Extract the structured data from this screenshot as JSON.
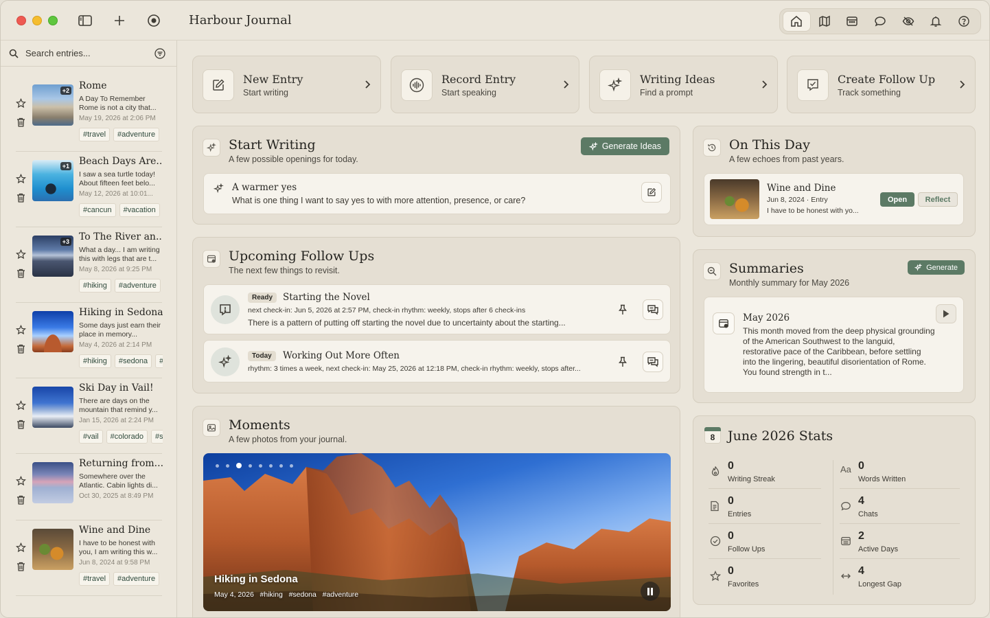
{
  "app": {
    "title": "Harbour Journal"
  },
  "search": {
    "placeholder": "Search entries..."
  },
  "entries": [
    {
      "title": "Rome",
      "snippet": "A Day To Remember Rome is not a city that...",
      "date": "May 19, 2026 at 2:06 PM",
      "badge": "+2",
      "tags": [
        "#travel",
        "#adventure"
      ]
    },
    {
      "title": "Beach Days Are...",
      "snippet": "I saw a sea turtle today! About fifteen feet belo...",
      "date": "May 12, 2026 at 10:01...",
      "badge": "+1",
      "tags": [
        "#cancun",
        "#vacation"
      ]
    },
    {
      "title": "To The River an...",
      "snippet": "What a day... I am writing this with legs that are t...",
      "date": "May 8, 2026 at 9:25 PM",
      "badge": "+3",
      "tags": [
        "#hiking",
        "#adventure"
      ]
    },
    {
      "title": "Hiking in Sedona",
      "snippet": "Some days just earn their place in memory...",
      "date": "May 4, 2026 at 2:14 PM",
      "badge": "",
      "tags": [
        "#hiking",
        "#sedona",
        "#adventure"
      ]
    },
    {
      "title": "Ski Day in Vail!",
      "snippet": "There are days on the mountain that remind y...",
      "date": "Jan 15, 2026 at 2:24 PM",
      "badge": "",
      "tags": [
        "#vail",
        "#colorado",
        "#ski"
      ]
    },
    {
      "title": "Returning from...",
      "snippet": "Somewhere over the Atlantic. Cabin lights di...",
      "date": "Oct 30, 2025 at 8:49 PM",
      "badge": "",
      "tags": []
    },
    {
      "title": "Wine and Dine",
      "snippet": "I have to be honest with you, I am writing this w...",
      "date": "Jun 8, 2024 at 9:58 PM",
      "badge": "",
      "tags": [
        "#travel",
        "#adventure"
      ]
    }
  ],
  "quick_actions": [
    {
      "title": "New Entry",
      "sub": "Start writing",
      "icon": "compose-icon"
    },
    {
      "title": "Record Entry",
      "sub": "Start speaking",
      "icon": "waveform-icon"
    },
    {
      "title": "Writing Ideas",
      "sub": "Find a prompt",
      "icon": "sparkles-icon"
    },
    {
      "title": "Create Follow Up",
      "sub": "Track something",
      "icon": "checkbox-icon"
    }
  ],
  "start_writing": {
    "title": "Start Writing",
    "sub": "A few possible openings for today.",
    "button": "Generate Ideas",
    "prompt_title": "A warmer yes",
    "prompt_text": "What is one thing I want to say yes to with more attention, presence, or care?"
  },
  "follow_ups": {
    "title": "Upcoming Follow Ups",
    "sub": "The next few things to revisit.",
    "items": [
      {
        "status": "Ready",
        "title": "Starting the Novel",
        "meta": "next check-in: Jun 5, 2026 at 2:57 PM, check-in rhythm: weekly, stops after 6 check-ins",
        "text": "There is a pattern of putting off starting the novel due to uncertainty about the starting..."
      },
      {
        "status": "Today",
        "title": "Working Out More Often",
        "meta": "rhythm: 3 times a week, next check-in: May 25, 2026 at 12:18 PM, check-in rhythm: weekly, stops after...",
        "text": ""
      }
    ]
  },
  "moments": {
    "title": "Moments",
    "sub": "A few photos from your journal.",
    "photo_title": "Hiking in Sedona",
    "photo_meta": "May 4, 2026   #hiking   #sedona   #adventure",
    "dots": 8,
    "active_dot": 2
  },
  "on_this_day": {
    "title": "On This Day",
    "sub": "A few echoes from past years.",
    "entry_title": "Wine and Dine",
    "entry_meta": "Jun 8, 2024 · Entry",
    "entry_snip": "I have to be honest with yo...",
    "open": "Open",
    "reflect": "Reflect"
  },
  "summaries": {
    "title": "Summaries",
    "sub": "Monthly summary for May 2026",
    "button": "Generate",
    "month": "May 2026",
    "text": "This month moved from the deep physical grounding of the American Southwest to the languid, restorative pace of the Caribbean, before settling into the lingering, beautiful disorientation of Rome. You found strength in t..."
  },
  "stats": {
    "title": "June 2026 Stats",
    "cal_day": "8",
    "items": [
      {
        "value": "0",
        "label": "Writing Streak",
        "icon": "flame-icon"
      },
      {
        "value": "0",
        "label": "Words Written",
        "icon": "text-size-icon"
      },
      {
        "value": "0",
        "label": "Entries",
        "icon": "document-icon"
      },
      {
        "value": "4",
        "label": "Chats",
        "icon": "chat-bubble-icon"
      },
      {
        "value": "0",
        "label": "Follow Ups",
        "icon": "check-circle-icon"
      },
      {
        "value": "2",
        "label": "Active Days",
        "icon": "calendar-icon"
      },
      {
        "value": "0",
        "label": "Favorites",
        "icon": "star-icon"
      },
      {
        "value": "4",
        "label": "Longest Gap",
        "icon": "arrows-horizontal-icon"
      }
    ]
  },
  "colors": {
    "accent": "#5c7a65",
    "background": "#ebe6db",
    "card": "#e5dfd3"
  }
}
